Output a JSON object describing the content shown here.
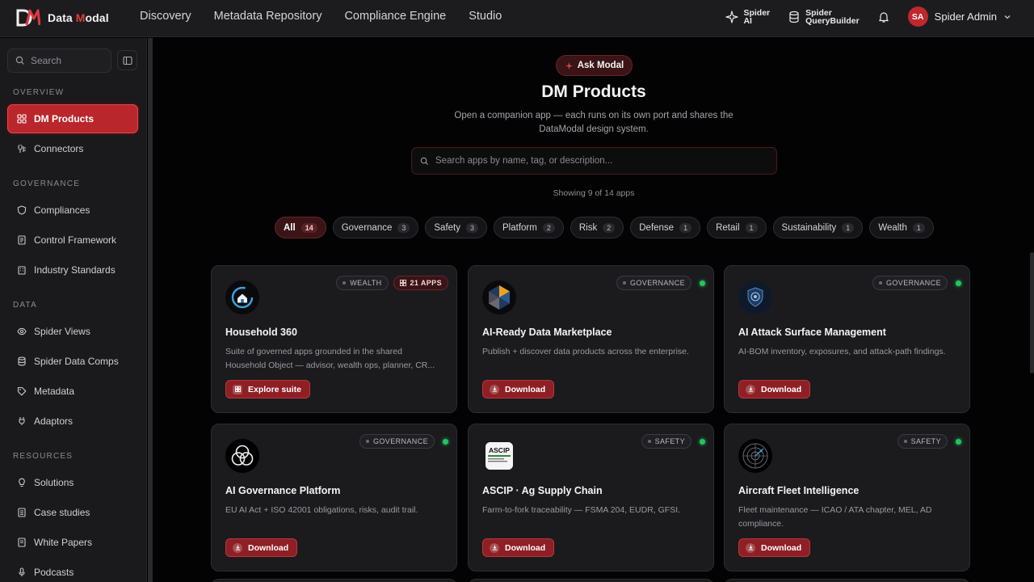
{
  "brand": {
    "name_part1": "Data ",
    "name_accent": "M",
    "name_part2": "odal"
  },
  "nav": [
    "Discovery",
    "Metadata Repository",
    "Compliance Engine",
    "Studio"
  ],
  "tools": {
    "spider_ai": {
      "line1": "Spider",
      "line2": "AI"
    },
    "query_builder": {
      "line1": "Spider",
      "line2": "QueryBuilder"
    }
  },
  "user": {
    "initials": "SA",
    "name": "Spider Admin"
  },
  "sidebar": {
    "search_placeholder": "Search",
    "sections": {
      "overview": "OVERVIEW",
      "governance": "GOVERNANCE",
      "data": "DATA",
      "resources": "RESOURCES"
    },
    "items": {
      "dm_products": "DM Products",
      "connectors": "Connectors",
      "compliances": "Compliances",
      "control_framework": "Control Framework",
      "industry_standards": "Industry Standards",
      "spider_views": "Spider Views",
      "spider_data_comps": "Spider Data Comps",
      "metadata": "Metadata",
      "adaptors": "Adaptors",
      "solutions": "Solutions",
      "case_studies": "Case studies",
      "white_papers": "White Papers",
      "podcasts": "Podcasts"
    }
  },
  "main": {
    "ask_label": "Ask Modal",
    "title": "DM Products",
    "subtitle": "Open a companion app — each runs on its own port and shares the DataModal design system.",
    "search_placeholder": "Search apps by name, tag, or description...",
    "showing": "Showing 9 of 14 apps",
    "filters": [
      {
        "label": "All",
        "count": "14"
      },
      {
        "label": "Governance",
        "count": "3"
      },
      {
        "label": "Safety",
        "count": "3"
      },
      {
        "label": "Platform",
        "count": "2"
      },
      {
        "label": "Risk",
        "count": "2"
      },
      {
        "label": "Defense",
        "count": "1"
      },
      {
        "label": "Retail",
        "count": "1"
      },
      {
        "label": "Sustainability",
        "count": "1"
      },
      {
        "label": "Wealth",
        "count": "1"
      }
    ]
  },
  "cards": [
    {
      "title": "Household 360",
      "desc": "Suite of governed apps grounded in the shared Household Object — advisor, wealth ops, planner, CR...",
      "tag": "WEALTH",
      "apps": "21 APPS",
      "button": "Explore suite"
    },
    {
      "title": "AI-Ready Data Marketplace",
      "desc": "Publish + discover data products across the enterprise.",
      "tag": "GOVERNANCE",
      "button": "Download"
    },
    {
      "title": "AI Attack Surface Management",
      "desc": "AI-BOM inventory, exposures, and attack-path findings.",
      "tag": "GOVERNANCE",
      "button": "Download"
    },
    {
      "title": "AI Governance Platform",
      "desc": "EU AI Act + ISO 42001 obligations, risks, audit trail.",
      "tag": "GOVERNANCE",
      "button": "Download"
    },
    {
      "title": "ASCIP · Ag Supply Chain",
      "desc": "Farm-to-fork traceability — FSMA 204, EUDR, GFSI.",
      "tag": "SAFETY",
      "button": "Download",
      "logo_text": "ASCIP"
    },
    {
      "title": "Aircraft Fleet Intelligence",
      "desc": "Fleet maintenance — ICAO / ATA chapter, MEL, AD compliance.",
      "tag": "SAFETY",
      "button": "Download"
    }
  ],
  "colors": {
    "accent": "#c0272d",
    "status_ok": "#22c55e",
    "background": "#030303"
  }
}
